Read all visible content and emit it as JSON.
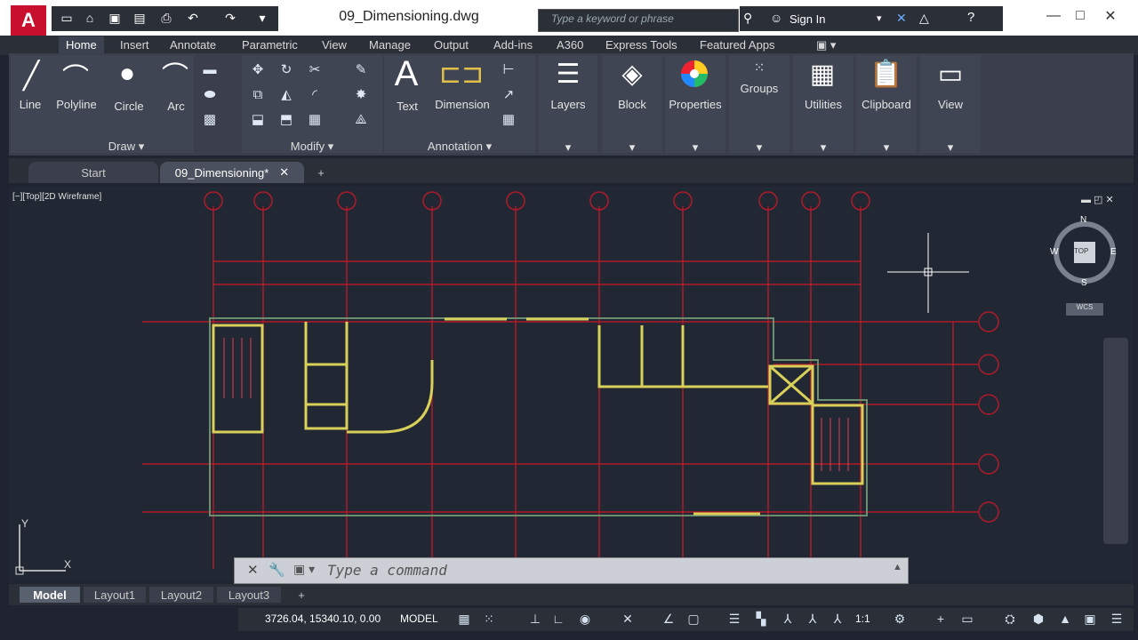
{
  "window": {
    "doc_title": "09_Dimensioning.dwg",
    "search_placeholder": "Type a keyword or phrase",
    "sign_in": "Sign In",
    "logo": "A"
  },
  "ribbon_tabs": [
    "Home",
    "Insert",
    "Annotate",
    "Parametric",
    "View",
    "Manage",
    "Output",
    "Add-ins",
    "A360",
    "Express Tools",
    "Featured Apps"
  ],
  "draw_panel": {
    "name": "Draw",
    "buttons": [
      "Line",
      "Polyline",
      "Circle",
      "Arc"
    ]
  },
  "modify_panel": {
    "name": "Modify"
  },
  "annotation_panel": {
    "name": "Annotation",
    "buttons": [
      "Text",
      "Dimension"
    ]
  },
  "big_panels": [
    "Layers",
    "Block",
    "Properties",
    "Groups",
    "Utilities",
    "Clipboard",
    "View"
  ],
  "doc_tabs": [
    "Start",
    "09_Dimensioning*"
  ],
  "viewport_label": "[−][Top][2D Wireframe]",
  "viewcube": {
    "top": "TOP",
    "n": "N",
    "s": "S",
    "e": "E",
    "w": "W",
    "wcs": "WCS"
  },
  "command": {
    "placeholder": "Type a command"
  },
  "layout_tabs": [
    "Model",
    "Layout1",
    "Layout2",
    "Layout3"
  ],
  "status": {
    "coords": "3726.04, 15340.10, 0.00",
    "mode": "MODEL",
    "scale": "1:1"
  },
  "ucs": {
    "x": "X",
    "y": "Y"
  },
  "colors": {
    "accent": "#c8102e",
    "grid": "#c0152a",
    "wall": "#d9d05a",
    "bg": "#212833"
  }
}
